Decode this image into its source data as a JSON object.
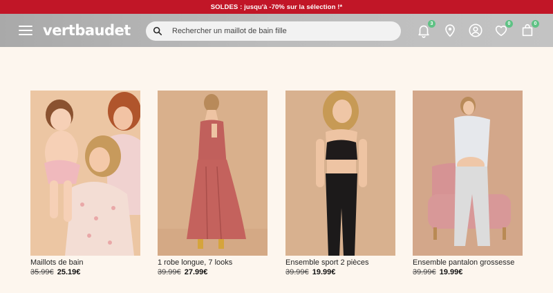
{
  "promo": {
    "text": "SOLDES : jusqu'à -70% sur la sélection !*"
  },
  "header": {
    "logo": "vertbaudet",
    "search_placeholder": "Rechercher un maillot de bain fille",
    "notifications_count": "3",
    "wishlist_count": "0",
    "cart_count": "0"
  },
  "products": [
    {
      "name": "Maillots de bain",
      "old_price": "35.99€",
      "new_price": "25.19€"
    },
    {
      "name": "1 robe longue, 7 looks",
      "old_price": "39.99€",
      "new_price": "27.99€"
    },
    {
      "name": "Ensemble sport 2 pièces",
      "old_price": "39.99€",
      "new_price": "19.99€"
    },
    {
      "name": "Ensemble pantalon grossesse",
      "old_price": "39.99€",
      "new_price": "19.99€"
    }
  ],
  "colors": {
    "promo_bg": "#c11627",
    "badge": "#5ec284",
    "page_bg": "#fdf6ee"
  }
}
